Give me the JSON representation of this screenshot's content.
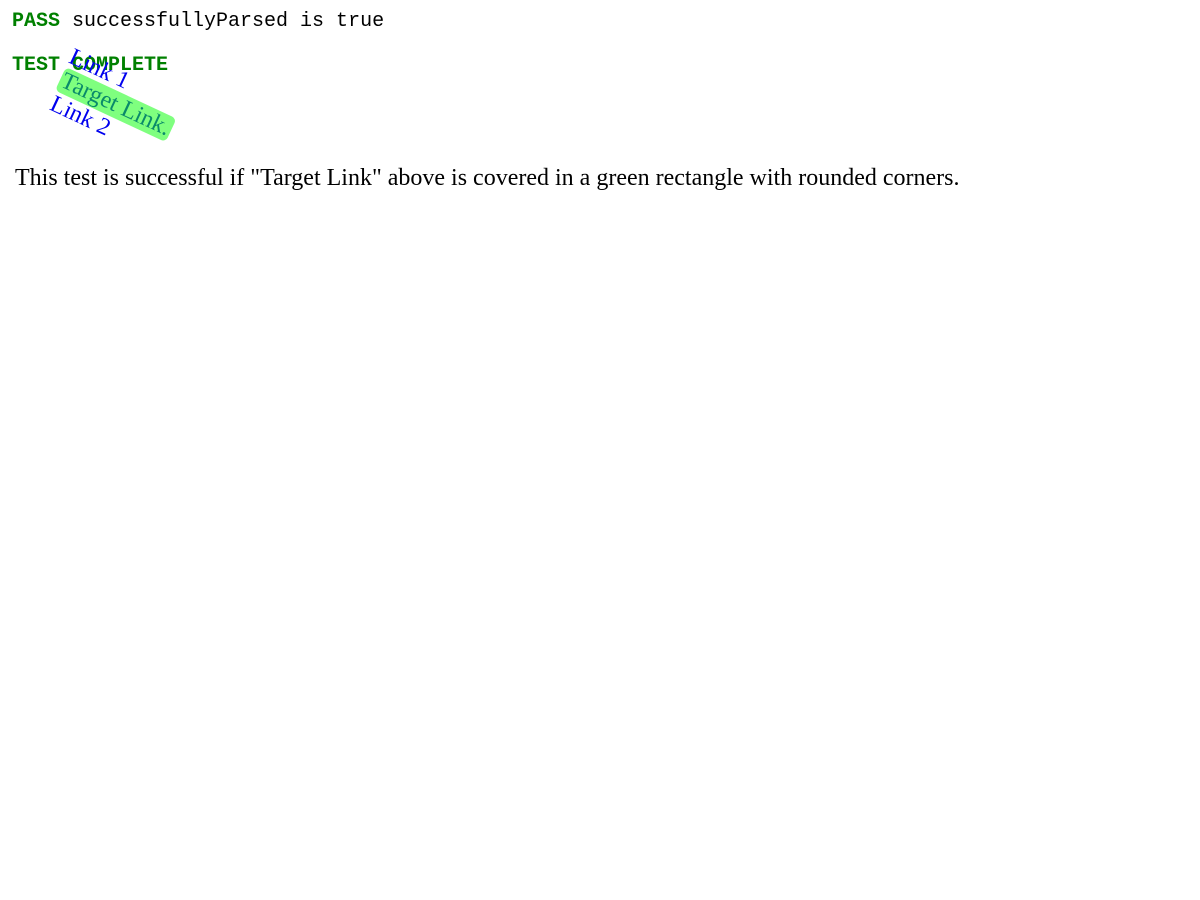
{
  "results": {
    "pass_label": "PASS",
    "pass_message": " successfullyParsed is true",
    "complete_label": "TEST COMPLETE"
  },
  "links": {
    "link1": "Link 1",
    "target": "Target Link.",
    "link2": "Link 2"
  },
  "description": "This test is successful if \"Target Link\" above is covered in a green rectangle with rounded corners.",
  "colors": {
    "pass": "#008000",
    "link": "#0000ee",
    "highlight": "#80ff80"
  }
}
